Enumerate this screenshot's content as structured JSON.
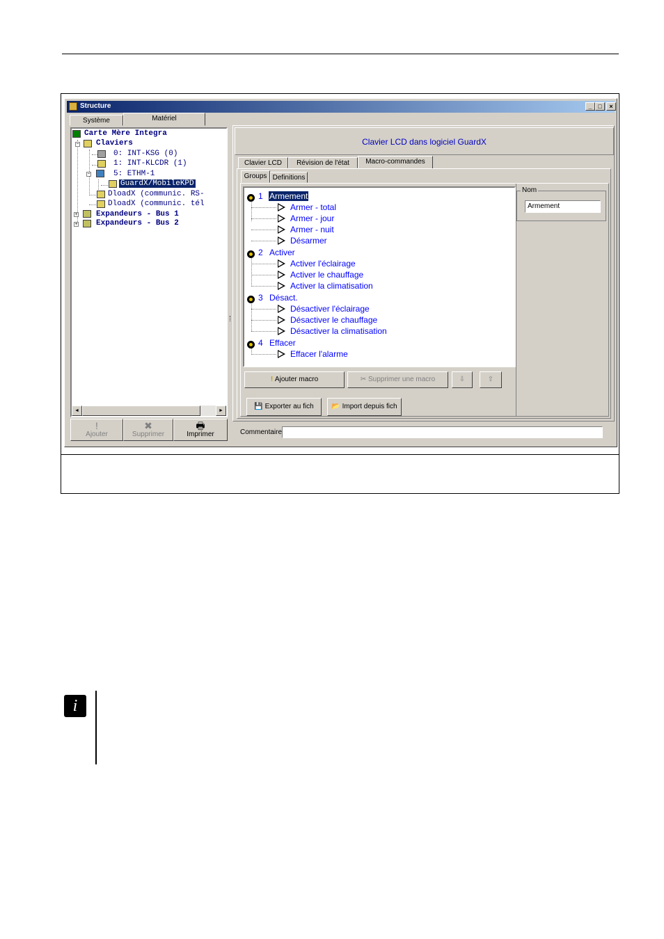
{
  "window": {
    "title": "Structure",
    "min_btn": "_",
    "max_btn": "□",
    "close_btn": "×"
  },
  "left_tabs": [
    "Système",
    "Matériel"
  ],
  "tree": {
    "items": [
      {
        "label": "Carte Mère Integra"
      },
      {
        "label": "Claviers"
      },
      {
        "label": "0: INT-KSG      (0)"
      },
      {
        "label": "1: INT-KLCDR    (1)"
      },
      {
        "label": "5: ETHM-1"
      },
      {
        "label": "GuardX/MobileKPD"
      },
      {
        "label": "DloadX (communic. RS-"
      },
      {
        "label": "DloadX (communic. tél"
      },
      {
        "label": "Expandeurs - Bus 1"
      },
      {
        "label": "Expandeurs - Bus 2"
      }
    ],
    "scroll_left": "◄",
    "scroll_right": "►"
  },
  "left_buttons": {
    "add": "Ajouter",
    "delete": "Supprimer",
    "print": "Imprimer"
  },
  "header": {
    "title": "Clavier LCD dans logiciel GuardX"
  },
  "main_tabs": [
    "Clavier LCD",
    "Révision de l'état",
    "Macro-commandes"
  ],
  "sub_tabs": [
    "Groups",
    "Definitions"
  ],
  "groups": [
    {
      "num": "1",
      "name": "Armement",
      "macros": [
        "Armer - total",
        "Armer - jour",
        "Armer - nuit",
        "Désarmer"
      ]
    },
    {
      "num": "2",
      "name": "Activer",
      "macros": [
        "Activer l'éclairage",
        "Activer le chauffage",
        "Activer la climatisation"
      ]
    },
    {
      "num": "3",
      "name": "Désact.",
      "macros": [
        "Désactiver l'éclairage",
        "Désactiver le chauffage",
        "Désactiver la climatisation"
      ]
    },
    {
      "num": "4",
      "name": "Effacer",
      "macros": [
        "Effacer l'alarme"
      ]
    }
  ],
  "action_buttons": {
    "add_macro": "Ajouter macro",
    "remove_macro": "Supprimer une macro",
    "down": "⇩",
    "up": "⇧",
    "export": "Exporter au fich",
    "import": "Import depuis fich"
  },
  "name_panel": {
    "label": "Nom",
    "value": "Armement"
  },
  "comment": {
    "label": "Commentaire:",
    "value": ""
  },
  "note_icon": "i"
}
